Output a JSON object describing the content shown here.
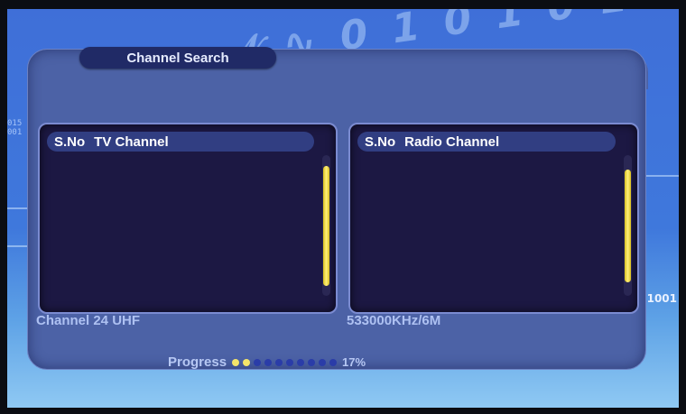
{
  "screen": {
    "title": "Channel Search",
    "tv_list": {
      "col_sno": "S.No",
      "col_name": "TV Channel",
      "items": [],
      "scroll_level": 0.85
    },
    "radio_list": {
      "col_sno": "S.No",
      "col_name": "Radio Channel",
      "items": [],
      "scroll_level": 0.8
    },
    "channel_info": "Channel  24  UHF",
    "frequency_info": "533000KHz/6M",
    "progress": {
      "label": "Progress",
      "value_text": "17%",
      "percent": 17,
      "total_dots": 10
    },
    "background": {
      "top_digits": "ℵ ₦ 0 1 0 1 0 1",
      "left_digits": "015\n001",
      "right_digits": "1001"
    },
    "colors": {
      "accent": "#f4e46a",
      "panel": "#4c62a6",
      "list_bg": "#1c1843"
    }
  }
}
